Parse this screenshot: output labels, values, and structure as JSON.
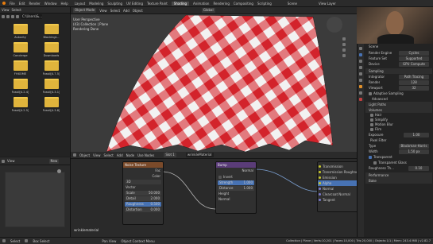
{
  "topbar": {
    "menus": [
      "File",
      "Edit",
      "Render",
      "Window",
      "Help"
    ],
    "tabs": [
      "Layout",
      "Modeling",
      "Sculpting",
      "UV Editing",
      "Texture Paint",
      "Shading",
      "Animation",
      "Rendering",
      "Compositing",
      "Scripting"
    ],
    "active_tab": "Shading",
    "scene": "Scene",
    "view_layer": "View Layer"
  },
  "filebrowser": {
    "menus": [
      "View",
      "Select"
    ],
    "path": "C:\\Users\\&...",
    "folders": [
      "Autocity",
      "Blockingt...",
      "Concierge",
      "Downloads",
      "FHXOME",
      "Fossil[4.7.5]",
      "Fossil[4.2.4]",
      "Fossil[4.3.1]",
      "Fossil[4.2.5]",
      "Fossil[4.3.8]"
    ]
  },
  "viewport": {
    "mode": "Object Mode",
    "menus": [
      "View",
      "Select",
      "Add",
      "Object"
    ],
    "global": "Global",
    "info": [
      "User Perspective",
      "(43) Collection | Plane",
      "Rendering Done"
    ]
  },
  "node_editor": {
    "header": [
      "Object",
      "View",
      "Select",
      "Add",
      "Node",
      "Use Nodes"
    ],
    "slot": "Slot 1",
    "material": "wrinkleMaterial",
    "node_label": "wrinklematerial",
    "noise": {
      "title": "Noise Texture",
      "outputs": [
        "Fac",
        "Color"
      ],
      "dim": "3D",
      "vector": "Vector",
      "fields": [
        [
          "Scale",
          "50.000"
        ],
        [
          "Detail",
          "2.000"
        ],
        [
          "Roughness",
          "0.500"
        ],
        [
          "Distortion",
          "0.000"
        ]
      ]
    },
    "bump": {
      "title": "Bump",
      "output": "Normal",
      "invert": "Invert",
      "fields": [
        [
          "Strength",
          "1.000"
        ],
        [
          "Distance",
          "1.000"
        ]
      ],
      "inputs": [
        "Height",
        "Normal"
      ]
    },
    "bsdf_sockets": [
      "Transmission",
      "Transmission Roughness",
      "Emission",
      "Alpha",
      "Normal",
      "Clearcoat Normal",
      "Tangent"
    ]
  },
  "left_bottom": {
    "menus": [
      "View"
    ],
    "new": "New"
  },
  "properties": {
    "scene": "Scene",
    "rows": [
      [
        "Render Engine",
        "Cycles"
      ],
      [
        "Feature Set",
        "Supported"
      ],
      [
        "Device",
        "GPU Compute"
      ]
    ],
    "sections": [
      "Sampling",
      "Light Paths",
      "Volumes",
      "Motion Blur",
      "Film",
      "Performance",
      "Bake"
    ],
    "sampling": [
      [
        "Integrator",
        "Path Tracing"
      ],
      [
        "Render",
        "128"
      ],
      [
        "Viewport",
        "32"
      ]
    ],
    "adaptive": "Adaptive Sampling",
    "advanced": "Advanced",
    "light_items": [
      "Hair",
      "Simplify",
      "Motion Blur",
      "Film"
    ],
    "exposure": [
      "Exposure",
      "1.00"
    ],
    "pixel_filter": "Pixel Filter",
    "filter": [
      [
        "Type",
        "Blackman-Harris"
      ],
      [
        "Width",
        "1.50 px"
      ]
    ],
    "transparent": "Transparent",
    "transparent_glass": "Transparent Glass",
    "roughness": [
      "Roughness Th...",
      "0.10"
    ]
  },
  "statusbar": {
    "left": [
      "Select",
      "Box Select"
    ],
    "mid": [
      "Pan View",
      "Object Context Menu"
    ],
    "right": "Collection | Plane | Verts:10,201 | Faces:10,000 | Tris:20,000 | Objects:1/1 | Mem: 243.4 MiB | v2.82.7"
  },
  "colors": {
    "accent": "#4772b3",
    "red": "#d3232b",
    "white": "#f2f2f2",
    "noise_header": "#7a4a2a",
    "bump_header": "#5a3c78"
  }
}
